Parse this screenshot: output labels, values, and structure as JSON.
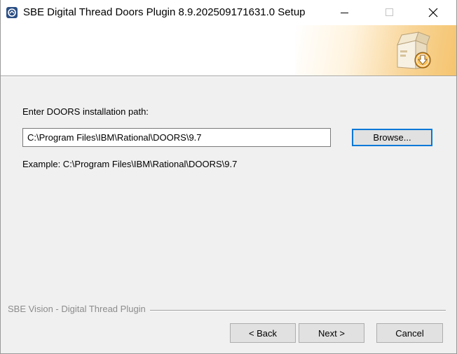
{
  "window": {
    "title": "SBE Digital Thread Doors Plugin 8.9.202509171631.0 Setup",
    "controls": {
      "minimize_icon": "minimize-icon",
      "maximize_icon": "maximize-icon",
      "close_icon": "close-icon"
    }
  },
  "header": {
    "icon": "installer-box-icon",
    "accent_color": "#f5c46e"
  },
  "content": {
    "path_label": "Enter DOORS installation path:",
    "path_value": "C:\\Program Files\\IBM\\Rational\\DOORS\\9.7",
    "browse_label": "Browse...",
    "example_text": "Example: C:\\Program Files\\IBM\\Rational\\DOORS\\9.7"
  },
  "footer": {
    "brand_text": "SBE Vision - Digital Thread Plugin",
    "back_label": "< Back",
    "next_label": "Next >",
    "cancel_label": "Cancel"
  },
  "colors": {
    "focus_border": "#0078d7",
    "window_bg": "#f0f0f0"
  }
}
